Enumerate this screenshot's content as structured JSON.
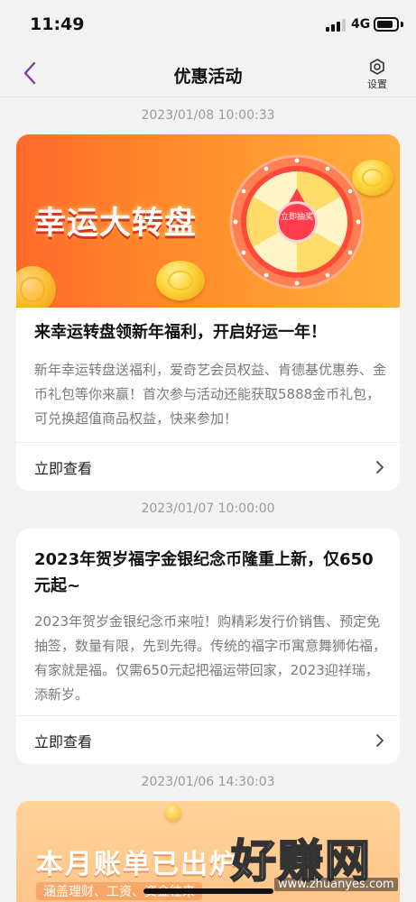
{
  "status_bar": {
    "time": "11:49",
    "network": "4G",
    "signal_bars": 3,
    "battery_level": 0.7
  },
  "nav": {
    "title": "优惠活动",
    "settings_label": "设置"
  },
  "posts": [
    {
      "timestamp": "2023/01/08 10:00:33",
      "banner": {
        "title": "幸运大转盘",
        "button": "立即抽奖"
      },
      "title": "来幸运转盘领新年福利，开启好运一年！",
      "description": "新年幸运转盘送福利，爱奇艺会员权益、肯德基优惠券、金币礼包等你来赢！首次参与活动还能获取5888金币礼包，可兑换超值商品权益，快来参加！",
      "action": "立即查看"
    },
    {
      "timestamp": "2023/01/07 10:00:00",
      "title": "2023年贺岁福字金银纪念币隆重上新，仅650元起~",
      "description": "2023年贺岁金银纪念币来啦！购精彩发行价销售、预定免抽签，数量有限，先到先得。传统的福字币寓意舞狮佑福，有家就是福。仅需650元起把福运带回家，2023迎祥瑞，添新岁。",
      "action": "立即查看"
    },
    {
      "timestamp": "2023/01/06 14:30:03",
      "banner": {
        "title": "本月账单已出炉",
        "subtitle": "涵盖理财、工资、资金往来"
      }
    }
  ],
  "watermark": {
    "text": "好赚网",
    "url": "www.zhuanyes.com"
  },
  "colors": {
    "accent": "#7b3fa0",
    "banner_orange": "#ff7a2a",
    "wheel_red": "#ff3d4e",
    "text_muted": "#7a7a7a"
  }
}
